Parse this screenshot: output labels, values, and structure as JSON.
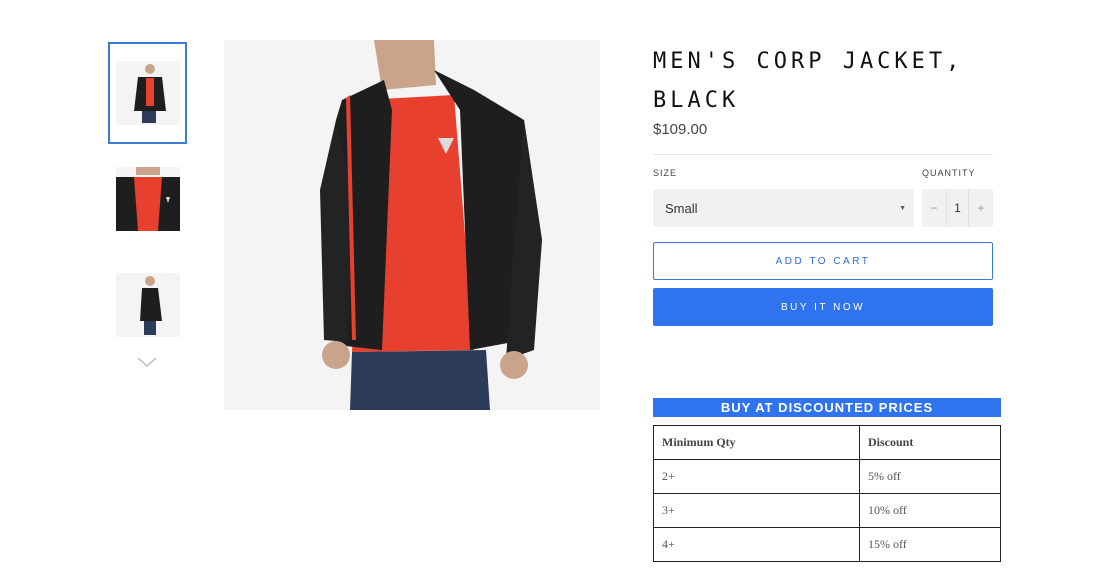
{
  "product": {
    "title": "MEN'S CORP JACKET, BLACK",
    "price": "$109.00"
  },
  "thumbnails": [
    {
      "label": "front view",
      "selected": true
    },
    {
      "label": "chest close-up",
      "selected": false
    },
    {
      "label": "side view",
      "selected": false
    }
  ],
  "form": {
    "size_label": "SIZE",
    "size_value": "Small",
    "quantity_label": "QUANTITY",
    "quantity_value": "1",
    "minus": "−",
    "plus": "+"
  },
  "buttons": {
    "add_to_cart": "ADD TO CART",
    "buy_now": "BUY IT NOW"
  },
  "discount": {
    "header": "BUY AT DISCOUNTED PRICES",
    "columns": [
      "Minimum Qty",
      "Discount"
    ],
    "rows": [
      [
        "2+",
        "5% off"
      ],
      [
        "3+",
        "10% off"
      ],
      [
        "4+",
        "15% off"
      ]
    ]
  },
  "colors": {
    "accent": "#2f74ee",
    "jacket": "#1e1e1e",
    "shirt": "#e8402f"
  },
  "icons": {
    "size_caret": "caret-down-icon",
    "thumb_next": "chevron-down-icon"
  }
}
